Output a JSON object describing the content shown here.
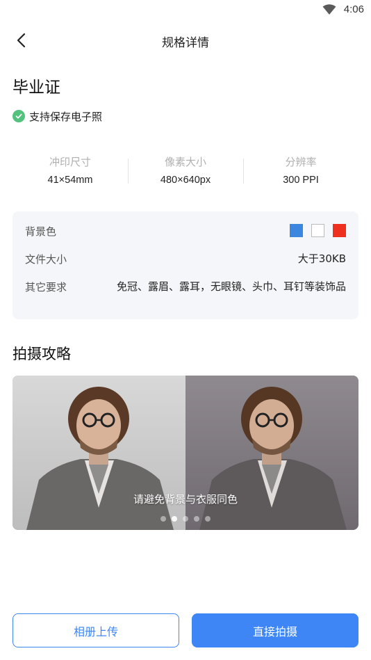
{
  "status_bar": {
    "time": "4:06"
  },
  "nav": {
    "title": "规格详情"
  },
  "product": {
    "title": "毕业证",
    "support_text": "支持保存电子照"
  },
  "specs": [
    {
      "label": "冲印尺寸",
      "value": "41×54mm"
    },
    {
      "label": "像素大小",
      "value": "480×640px"
    },
    {
      "label": "分辨率",
      "value": "300 PPI"
    }
  ],
  "info": {
    "background_label": "背景色",
    "background_colors": [
      "#3d86e0",
      "#ffffff",
      "#f0301f"
    ],
    "file_size_label": "文件大小",
    "file_size_value": "大于30KB",
    "other_label": "其它要求",
    "other_value": "免冠、露眉、露耳，无眼镜、头巾、耳钉等装饰品"
  },
  "guide": {
    "title": "拍摄攻略",
    "caption": "请避免背景与衣服同色",
    "slide_count": 5,
    "active_index": 1
  },
  "actions": {
    "upload_label": "相册上传",
    "shoot_label": "直接拍摄"
  },
  "colors": {
    "accent": "#3e86f5",
    "check": "#52c27c"
  }
}
